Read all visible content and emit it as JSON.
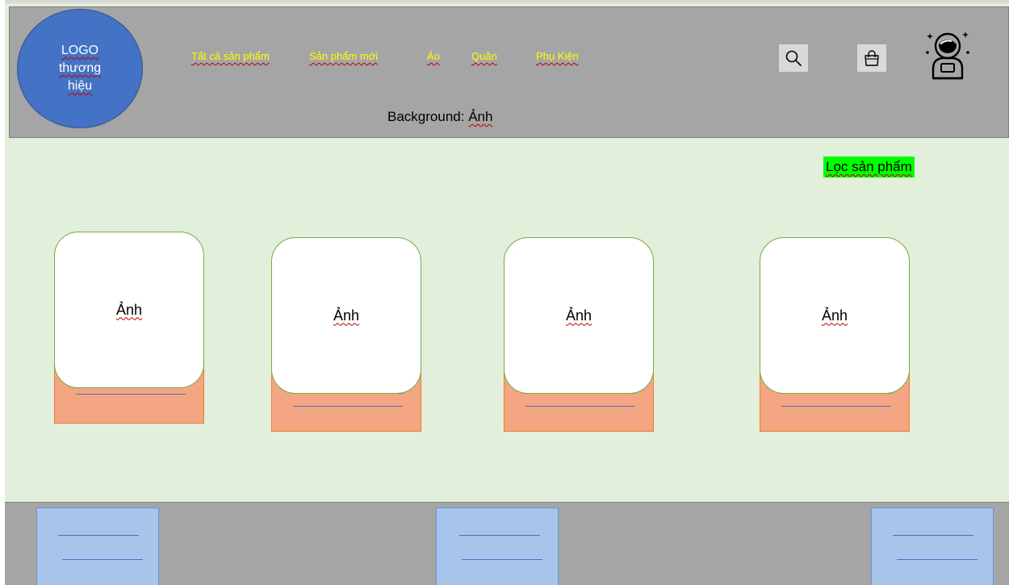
{
  "header": {
    "logo_text": "LOGO thương hiệu",
    "nav": [
      "Tất cả sản phẩm",
      "Sản phẩm mới",
      "Áo",
      "Quần",
      "Phụ Kiện"
    ],
    "background_label": "Background:",
    "background_label_word": "Ảnh",
    "icons": [
      "search-icon",
      "shopping-bag-icon",
      "astronaut-avatar-icon"
    ]
  },
  "filter": {
    "label": "Lọc sản phẩm"
  },
  "products": [
    {
      "image_label": "Ảnh"
    },
    {
      "image_label": "Ảnh"
    },
    {
      "image_label": "Ảnh"
    },
    {
      "image_label": "Ảnh"
    }
  ],
  "colors": {
    "header_bg": "#a5a5a5",
    "logo": "#4472c4",
    "nav_text": "#ffff00",
    "content_bg": "#e2efda",
    "filter_bg": "#00ff00",
    "card_base": "#f4a582",
    "card_border": "#70ad47",
    "footer_box": "#a9c4eb"
  }
}
